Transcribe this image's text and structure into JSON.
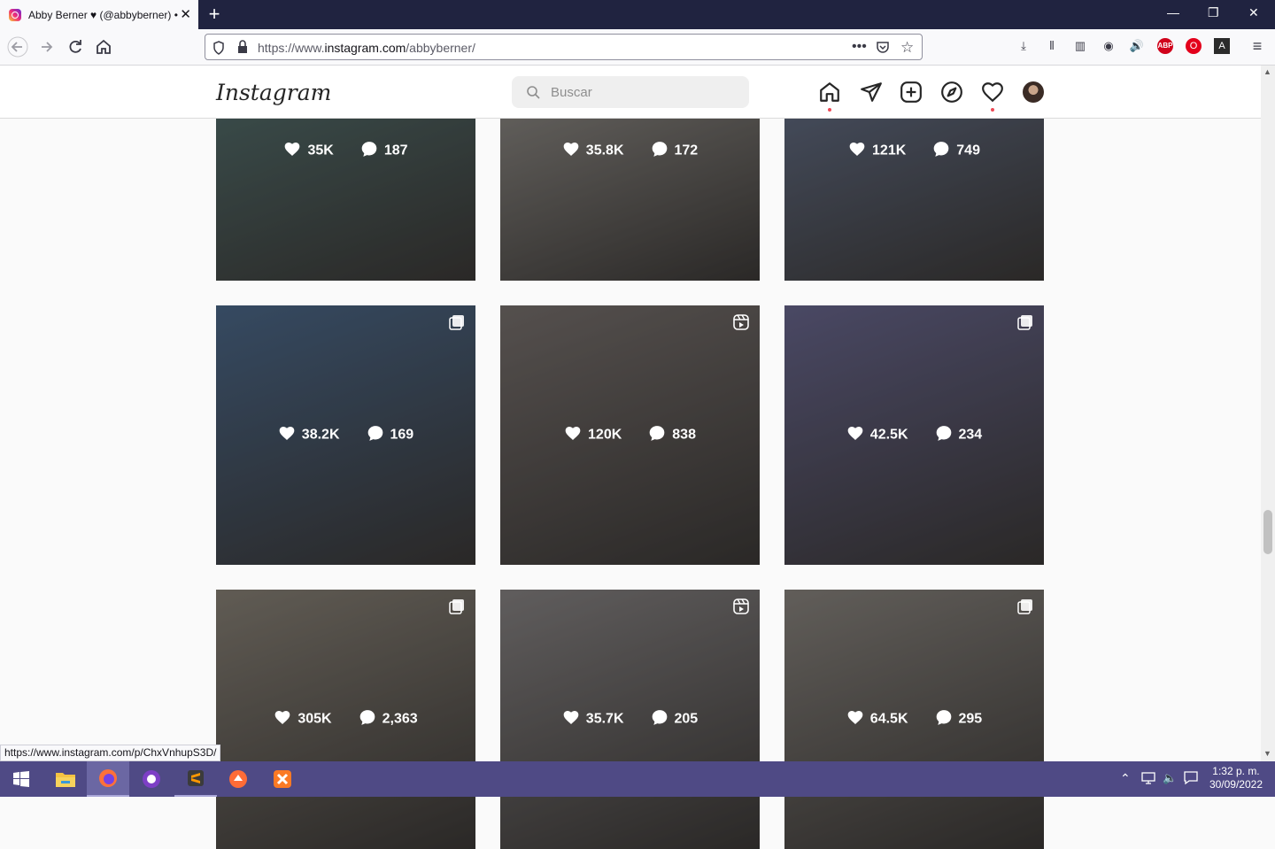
{
  "browser": {
    "tab_title": "Abby Berner ♥ (@abbyberner) •",
    "url_prefix": "https://www.",
    "url_domain": "instagram.com",
    "url_path": "/abbyberner/",
    "status_url": "https://www.instagram.com/p/ChxVnhupS3D/"
  },
  "instagram": {
    "logo": "Instagram",
    "search_placeholder": "Buscar"
  },
  "posts": [
    {
      "likes": "35K",
      "comments": "187",
      "bg": "#5a7c7a",
      "badge": "none"
    },
    {
      "likes": "35.8K",
      "comments": "172",
      "bg": "#a7a39d",
      "badge": "none"
    },
    {
      "likes": "121K",
      "comments": "749",
      "bg": "#6e7c9a",
      "badge": "none"
    },
    {
      "likes": "38.2K",
      "comments": "169",
      "bg": "#4d6a8c",
      "badge": "multi"
    },
    {
      "likes": "120K",
      "comments": "838",
      "bg": "#7a7370",
      "badge": "reel"
    },
    {
      "likes": "42.5K",
      "comments": "234",
      "bg": "#6a6890",
      "badge": "multi"
    },
    {
      "likes": "305K",
      "comments": "2,363",
      "bg": "#8b8479",
      "badge": "multi"
    },
    {
      "likes": "35.7K",
      "comments": "205",
      "bg": "#8a8686",
      "badge": "reel"
    },
    {
      "likes": "64.5K",
      "comments": "295",
      "bg": "#8c8781",
      "badge": "multi"
    }
  ],
  "taskbar": {
    "time": "1:32 p. m.",
    "date": "30/09/2022"
  }
}
